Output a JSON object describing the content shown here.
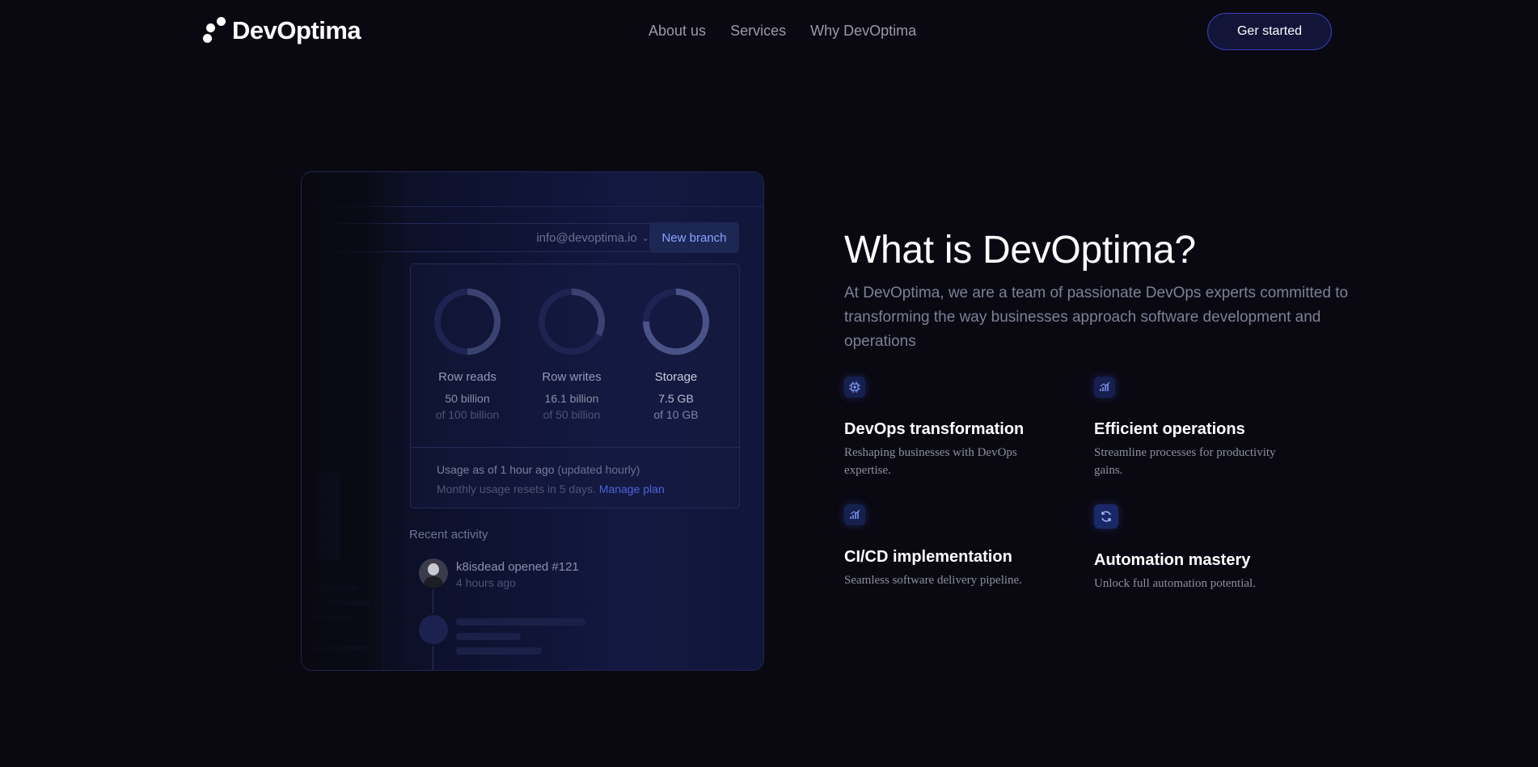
{
  "brand": {
    "name": "DevOptima"
  },
  "nav": {
    "links": [
      "About us",
      "Services",
      "Why DevOptima"
    ],
    "cta_label": "Ger started"
  },
  "mockup": {
    "email": "info@devoptima.io",
    "new_branch_label": "New branch",
    "gauges": [
      {
        "label": "Row reads",
        "value": "50 billion",
        "limit": "of 100 billion",
        "fraction": 0.5
      },
      {
        "label": "Row writes",
        "value": "16.1 billion",
        "limit": "of 50 billion",
        "fraction": 0.322
      },
      {
        "label": "Storage",
        "value": "7.5 GB",
        "limit": "of 10 GB",
        "fraction": 0.75
      }
    ],
    "usage_as_of": "Usage as of 1 hour ago",
    "usage_updated": "(updated hourly)",
    "monthly_reset": "Monthly usage resets in 5 days.",
    "manage_plan": "Manage plan",
    "recent_activity_title": "Recent activity",
    "activity": {
      "text": "k8isdead opened #121",
      "time": "4 hours ago"
    }
  },
  "section": {
    "heading": "What is DevOptima?",
    "intro": "At DevOptima, we are a team of passionate DevOps experts committed to transforming the way businesses approach software development and operations",
    "features": [
      {
        "icon": "chip-icon",
        "title": "DevOps transformation",
        "desc": "Reshaping businesses with DevOps expertise."
      },
      {
        "icon": "chart-icon",
        "title": "Efficient operations",
        "desc": "Streamline processes for productivity gains."
      },
      {
        "icon": "chart-icon",
        "title": "CI/CD implementation",
        "desc": "Seamless software delivery pipeline."
      },
      {
        "icon": "refresh-icon",
        "title": "Automation mastery",
        "desc": "Unlock full automation potential."
      }
    ]
  },
  "colors": {
    "background": "#0a0912",
    "accent": "#3b3fb5",
    "link": "#4d63d8"
  }
}
